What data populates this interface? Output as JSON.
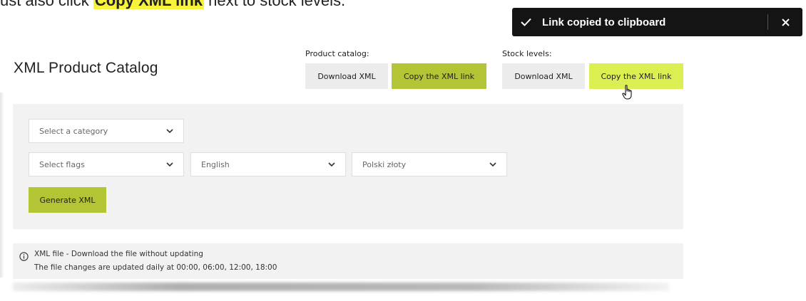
{
  "instruction": {
    "prefix": "ust also click ",
    "highlight": "Copy XML link",
    "suffix": " next to stock levels."
  },
  "toast": {
    "message": "Link copied to clipboard",
    "check_icon": "check-icon",
    "close_icon": "close-icon"
  },
  "page": {
    "title": "XML Product Catalog"
  },
  "product_catalog": {
    "label": "Product catalog:",
    "download_label": "Download XML",
    "copy_label": "Copy the XML link"
  },
  "stock_levels": {
    "label": "Stock levels:",
    "download_label": "Download XML",
    "copy_label": "Copy the XML link"
  },
  "form": {
    "category_placeholder": "Select a category",
    "flags_placeholder": "Select flags",
    "language_value": "English",
    "currency_value": "Polski złoty",
    "generate_label": "Generate XML"
  },
  "info": {
    "line1": "XML file - Download the file without updating",
    "line2": "The file changes are updated daily at 00:00, 06:00, 12:00, 18:00",
    "icon": "info-icon"
  },
  "colors": {
    "accent_green": "#b3c434",
    "accent_lime_hover": "#dcef52",
    "toast_bg": "#141414",
    "panel_bg": "#f2f2f2"
  }
}
